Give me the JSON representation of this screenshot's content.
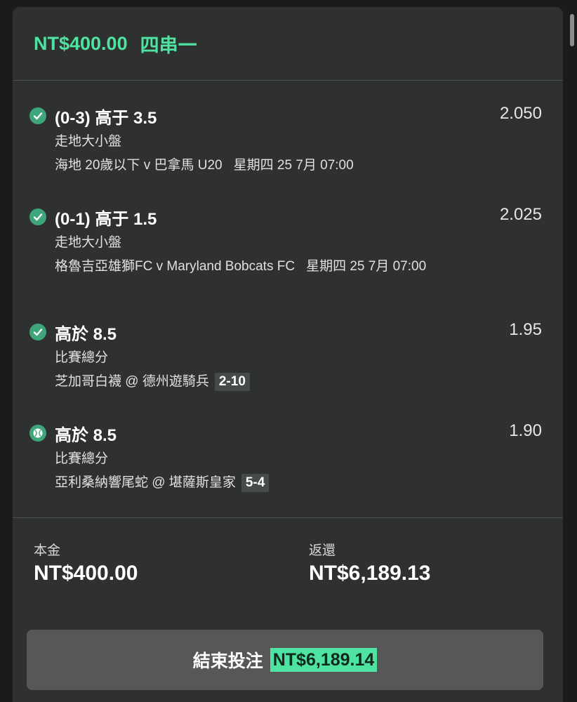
{
  "bet": {
    "stake_amount": "NT$400.00",
    "bet_type": "四串一"
  },
  "legs": [
    {
      "title": "(0-3) 高于 3.5",
      "odds": "2.050",
      "market": "走地大小盤",
      "event": "海地 20歲以下 v 巴拿馬 U20",
      "time": "星期四 25 7月 07:00",
      "score": "",
      "status": "won"
    },
    {
      "title": "(0-1) 高于 1.5",
      "odds": "2.025",
      "market": "走地大小盤",
      "event": "格魯吉亞雄獅FC v Maryland Bobcats FC",
      "time": "星期四 25 7月 07:00",
      "score": "",
      "status": "won"
    },
    {
      "title": "高於 8.5",
      "odds": "1.95",
      "market": "比賽總分",
      "event": "芝加哥白襪 @ 德州遊騎兵",
      "time": "",
      "score": "2-10",
      "status": "won"
    },
    {
      "title": "高於 8.5",
      "odds": "1.90",
      "market": "比賽總分",
      "event": "亞利桑納響尾蛇 @ 堪薩斯皇家",
      "time": "",
      "score": "5-4",
      "status": "live"
    }
  ],
  "summary": {
    "stake_label": "本金",
    "stake_value": "NT$400.00",
    "return_label": "返還",
    "return_value": "NT$6,189.13"
  },
  "cashout": {
    "label": "結束投注",
    "amount": "NT$6,189.14"
  },
  "colors": {
    "accent": "#4fe3a1",
    "check": "#3fa57b",
    "card_bg": "#2e312f"
  }
}
